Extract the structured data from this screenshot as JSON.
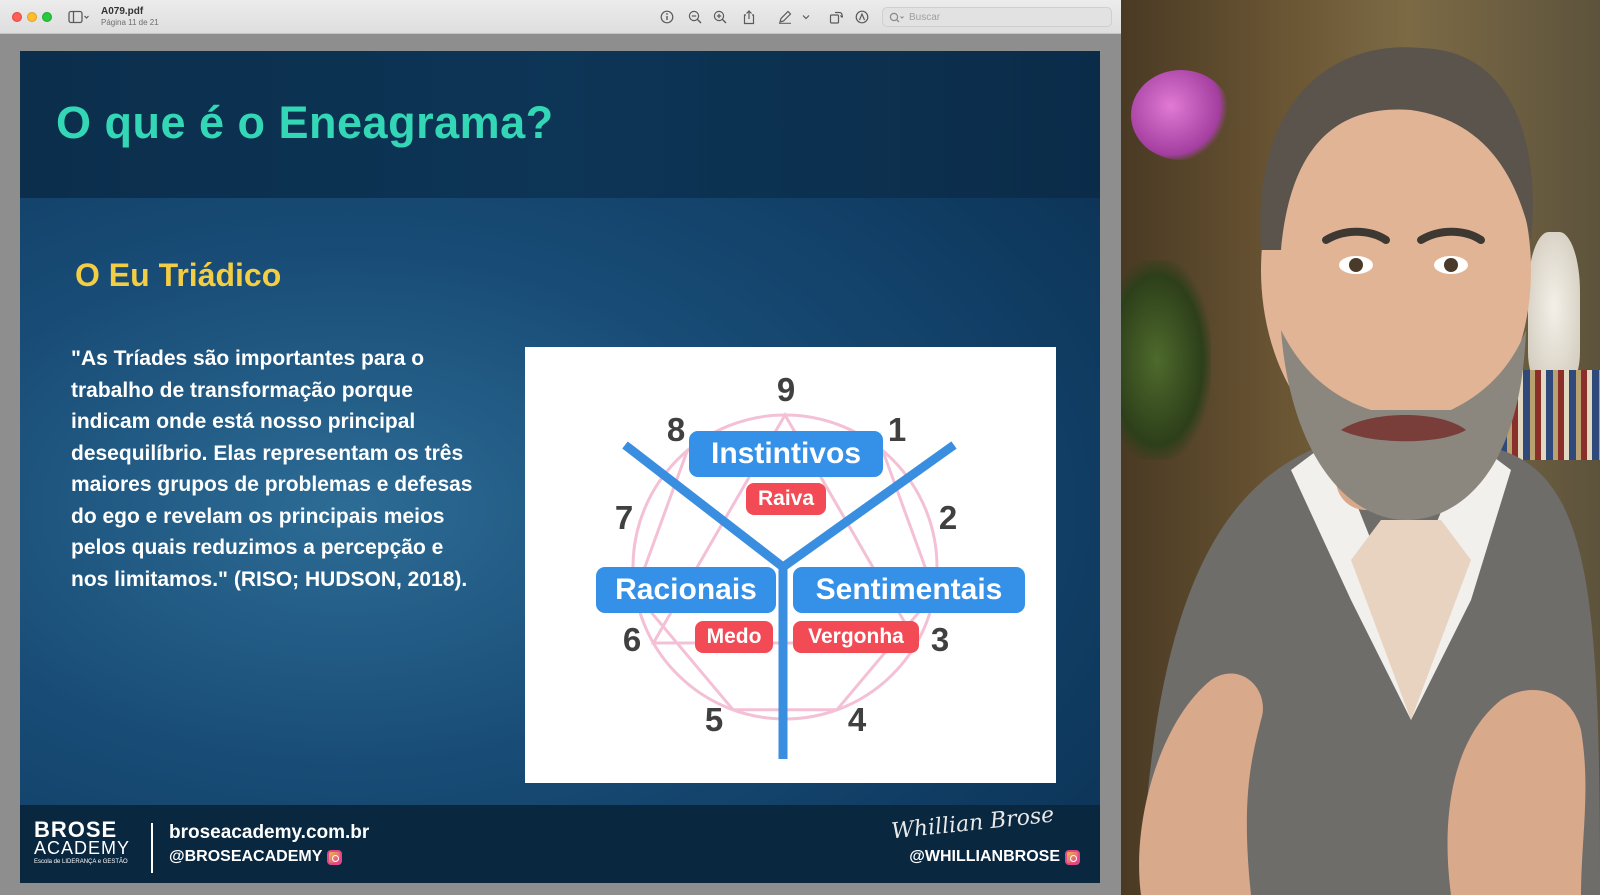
{
  "viewer": {
    "document_name": "A079.pdf",
    "page_info": "Página 11 de 21",
    "search_placeholder": "Buscar"
  },
  "slide": {
    "title": "O que é o Eneagrama?",
    "subtitle": "O Eu Triádico",
    "quote": "\"As Tríades são importantes para o trabalho de transformação porque indicam onde está nosso principal desequilíbrio. Elas representam os três maiores grupos de problemas e defesas do ego e revelam os principais meios pelos quais reduzimos a percepção e nos limitamos.\" (RISO; HUDSON, 2018).",
    "diagram": {
      "numbers": [
        "9",
        "1",
        "2",
        "3",
        "4",
        "5",
        "6",
        "7",
        "8"
      ],
      "triads": [
        {
          "name": "Instintivos",
          "emotion": "Raiva"
        },
        {
          "name": "Racionais",
          "emotion": "Medo"
        },
        {
          "name": "Sentimentais",
          "emotion": "Vergonha"
        }
      ],
      "colors": {
        "triad_pill": "#3590e8",
        "emotion_tag": "#f24b55",
        "lines": "#3a8ee0",
        "enneagram": "#f2b6cf"
      }
    },
    "footer": {
      "brand_line1": "BROSE",
      "brand_line2": "ACADEMY",
      "brand_tagline": "Escola de LIDERANÇA e GESTÃO",
      "website": "broseacademy.com.br",
      "handle_left": "@BROSEACADEMY",
      "handle_right": "@WHILLIANBROSE",
      "signature": "Whillian Brose"
    }
  }
}
